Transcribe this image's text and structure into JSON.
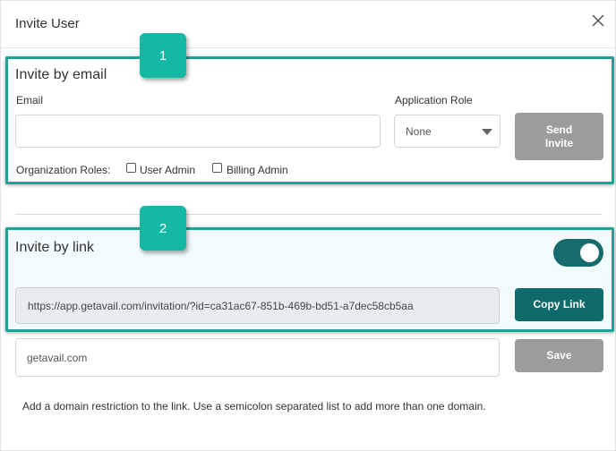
{
  "dialog": {
    "title": "Invite User",
    "close_icon": "close-icon"
  },
  "badges": {
    "one": "1",
    "two": "2"
  },
  "email_section": {
    "heading": "Invite by email",
    "email_label": "Email",
    "email_value": "",
    "role_label": "Application Role",
    "role_value": "None",
    "send_button": "Send\nInvite",
    "org_roles_label": "Organization Roles:",
    "checkbox_user_admin": "User Admin",
    "checkbox_billing_admin": "Billing Admin"
  },
  "link_section": {
    "heading": "Invite by link",
    "toggle_on": true,
    "link_value": "https://app.getavail.com/invitation/?id=ca31ac67-851b-469b-bd51-a7dec58cb5aa",
    "copy_button": "Copy Link",
    "domain_value": "getavail.com",
    "save_button": "Save",
    "help_text": "Add a domain restriction to the link. Use a semicolon separated list to add more than one domain."
  },
  "colors": {
    "accent_teal": "#16b8a3",
    "box_border": "#17a596",
    "primary_button": "#116a6a",
    "disabled_button": "#9c9c9c"
  }
}
